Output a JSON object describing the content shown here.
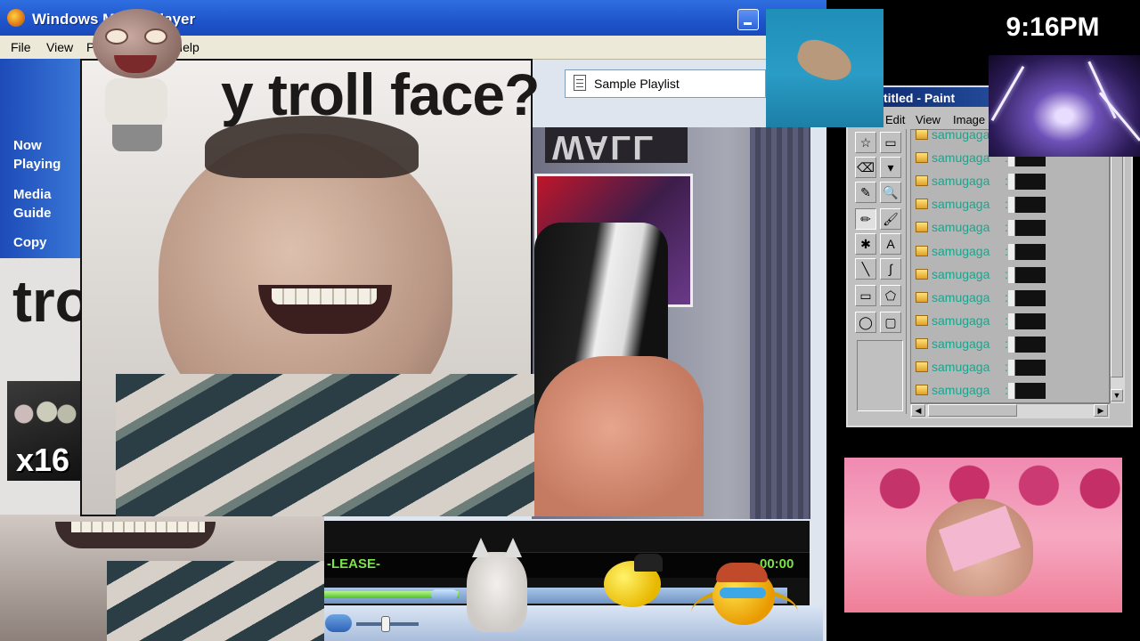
{
  "clock": "9:16PM",
  "wmp": {
    "title": "Windows Media Player",
    "menu": [
      "File",
      "View",
      "P",
      "Help"
    ],
    "sidebar": [
      "Now Playing",
      "Media Guide",
      "Copy"
    ],
    "playlist": "Sample Playlist",
    "lcd_text": "-LEASE-",
    "time": "00:00",
    "seek_progress": 0.29,
    "volume_level": 0.4
  },
  "video": {
    "troll_caption": "y troll face?",
    "left_caption": "tro",
    "multiplier": "x16",
    "sign_text": "WALL"
  },
  "paint": {
    "title": "titled - Paint",
    "menu": [
      "Edit",
      "View",
      "Image"
    ],
    "tools": [
      "☆",
      "▭",
      "⌫",
      "▾",
      "✎",
      "🔍",
      "✏",
      "🖌",
      "✱",
      "A",
      "╲",
      "∫",
      "▭",
      "⬠",
      "◯",
      "▢"
    ],
    "chat": [
      {
        "user": "samugaga",
        "sep": ":"
      },
      {
        "user": "samugaga",
        "sep": ":"
      },
      {
        "user": "samugaga",
        "sep": ":"
      },
      {
        "user": "samugaga",
        "sep": ":"
      },
      {
        "user": "samugaga",
        "sep": ":"
      },
      {
        "user": "samugaga",
        "sep": ":"
      },
      {
        "user": "samugaga",
        "sep": ":"
      },
      {
        "user": "samugaga",
        "sep": ":"
      },
      {
        "user": "samugaga",
        "sep": ":"
      },
      {
        "user": "samugaga",
        "sep": ":"
      },
      {
        "user": "samugaga",
        "sep": ":"
      },
      {
        "user": "samugaga",
        "sep": ":"
      }
    ]
  },
  "colors": {
    "xp_blue": "#1d52c9",
    "lcd_green": "#7ce24a",
    "chat_user": "#1aa58d"
  }
}
